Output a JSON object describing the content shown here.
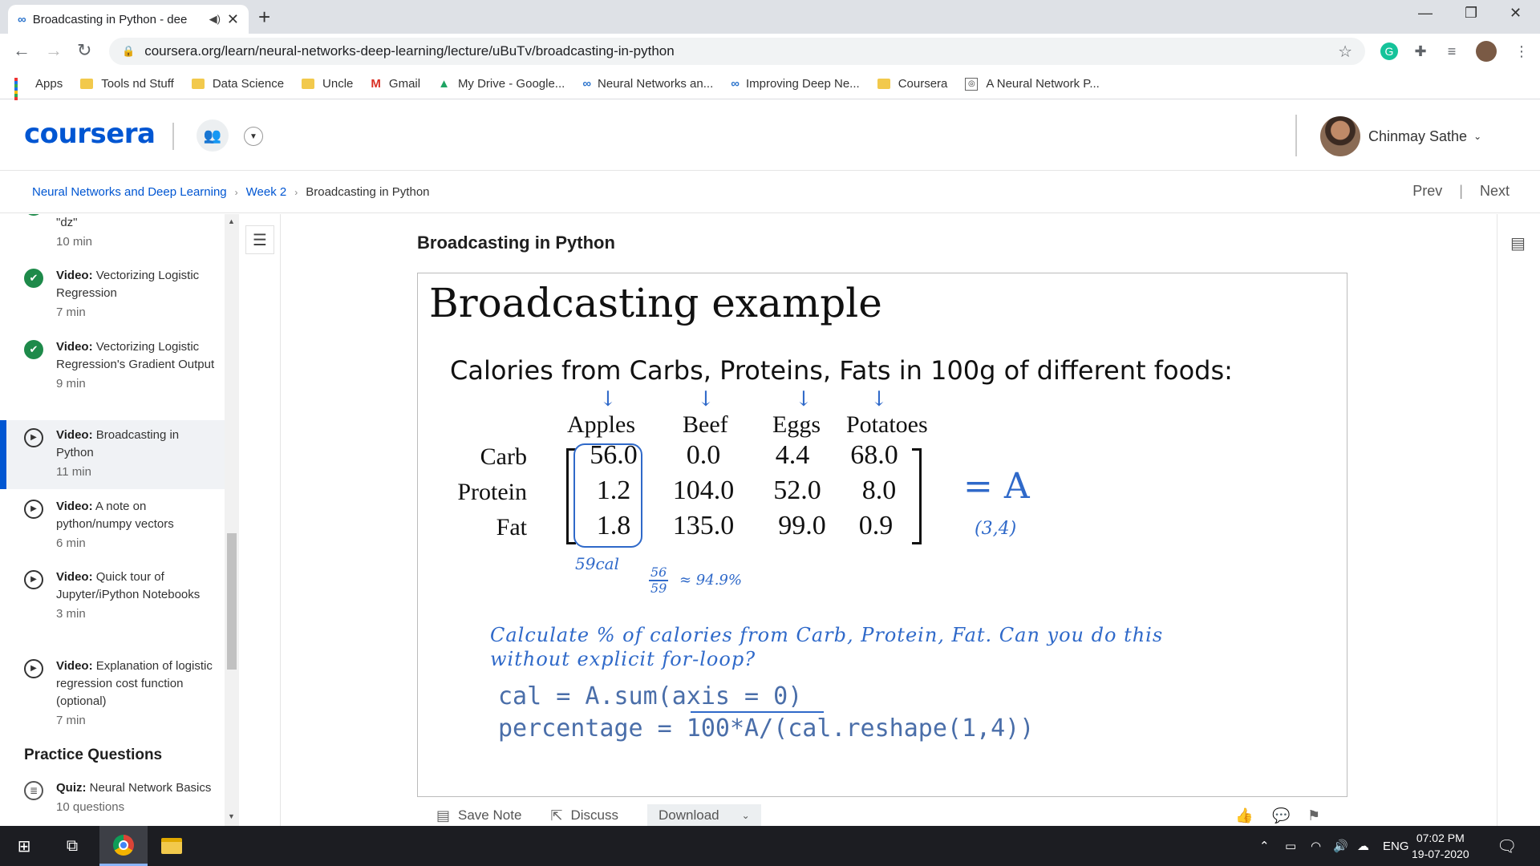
{
  "browser": {
    "tab_title": "Broadcasting in Python - dee",
    "url": "coursera.org/learn/neural-networks-deep-learning/lecture/uBuTv/broadcasting-in-python",
    "bookmarks": [
      "Apps",
      "Tools nd Stuff",
      "Data Science",
      "Uncle",
      "Gmail",
      "My Drive - Google...",
      "Neural Networks an...",
      "Improving Deep Ne...",
      "Coursera",
      "A Neural Network P..."
    ]
  },
  "header": {
    "logo": "coursera",
    "user_name": "Chinmay Sathe"
  },
  "breadcrumb": {
    "course": "Neural Networks and Deep Learning",
    "week": "Week 2",
    "current": "Broadcasting in Python",
    "prev": "Prev",
    "next": "Next"
  },
  "sidebar": {
    "items": [
      {
        "title": "\"dz\"",
        "duration": "10 min",
        "status": "done"
      },
      {
        "kind": "Video:",
        "title": "Vectorizing Logistic Regression",
        "duration": "7 min",
        "status": "done"
      },
      {
        "kind": "Video:",
        "title": "Vectorizing Logistic Regression's Gradient Output",
        "duration": "9 min",
        "status": "done"
      },
      {
        "kind": "Video:",
        "title": "Broadcasting in Python",
        "duration": "11 min",
        "status": "active"
      },
      {
        "kind": "Video:",
        "title": "A note on python/numpy vectors",
        "duration": "6 min",
        "status": "play"
      },
      {
        "kind": "Video:",
        "title": "Quick tour of Jupyter/iPython Notebooks",
        "duration": "3 min",
        "status": "play"
      },
      {
        "kind": "Video:",
        "title": "Explanation of logistic regression cost function (optional)",
        "duration": "7 min",
        "status": "play"
      }
    ],
    "section_title": "Practice Questions",
    "quiz": {
      "kind": "Quiz:",
      "title": "Neural Network Basics",
      "duration": "10 questions"
    }
  },
  "lecture": {
    "title": "Broadcasting in Python",
    "slide": {
      "heading": "Broadcasting example",
      "subheading": "Calories from Carbs, Proteins, Fats in 100g of different foods:",
      "columns": [
        "Apples",
        "Beef",
        "Eggs",
        "Potatoes"
      ],
      "rows": [
        {
          "label": "Carb",
          "values": [
            "56.0",
            "0.0",
            "4.4",
            "68.0"
          ]
        },
        {
          "label": "Protein",
          "values": [
            "1.2",
            "104.0",
            "52.0",
            "8.0"
          ]
        },
        {
          "label": "Fat",
          "values": [
            "1.8",
            "135.0",
            "99.0",
            "0.9"
          ]
        }
      ],
      "handwriting": {
        "matrix_name": "= A",
        "shape": "(3,4)",
        "sum_note": "59cal",
        "frac_num": "56",
        "frac_den": "59",
        "approx": "≈ 94.9%",
        "task": "Calculate % of calories from Carb, Protein, Fat. Can you do this without explicit for-loop?"
      },
      "code_line1": "cal = A.sum(axis = 0)",
      "code_line2": "percentage = 100*A/(cal.reshape(1,4))"
    },
    "toolbar": {
      "save_note": "Save Note",
      "discuss": "Discuss",
      "download": "Download"
    }
  },
  "taskbar": {
    "lang": "ENG",
    "time": "07:02 PM",
    "date": "19-07-2020"
  }
}
